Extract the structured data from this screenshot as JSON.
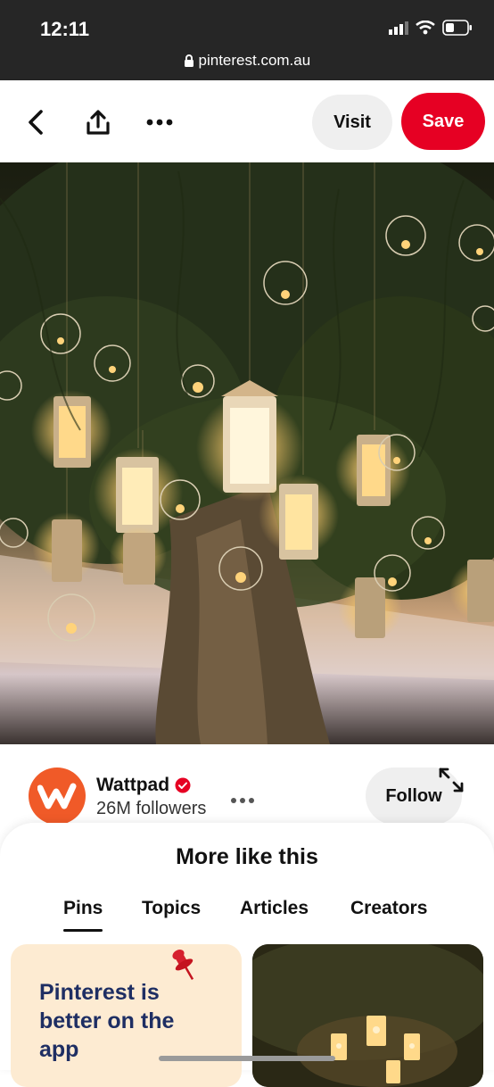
{
  "status_bar": {
    "time": "12:11",
    "url": "pinterest.com.au"
  },
  "toolbar": {
    "visit_label": "Visit",
    "save_label": "Save"
  },
  "creator": {
    "name": "Wattpad",
    "followers": "26M followers",
    "follow_label": "Follow",
    "avatar_letter": "w"
  },
  "more_like_this": {
    "title": "More like this",
    "tabs": [
      {
        "label": "Pins",
        "active": true
      },
      {
        "label": "Topics"
      },
      {
        "label": "Articles"
      },
      {
        "label": "Creators"
      }
    ]
  },
  "promo_card": {
    "text": "Pinterest is better on the app"
  },
  "colors": {
    "save_red": "#e60023",
    "promo_bg": "#fdebd2",
    "promo_text": "#1e2e63",
    "avatar_orange": "#f05a28"
  }
}
